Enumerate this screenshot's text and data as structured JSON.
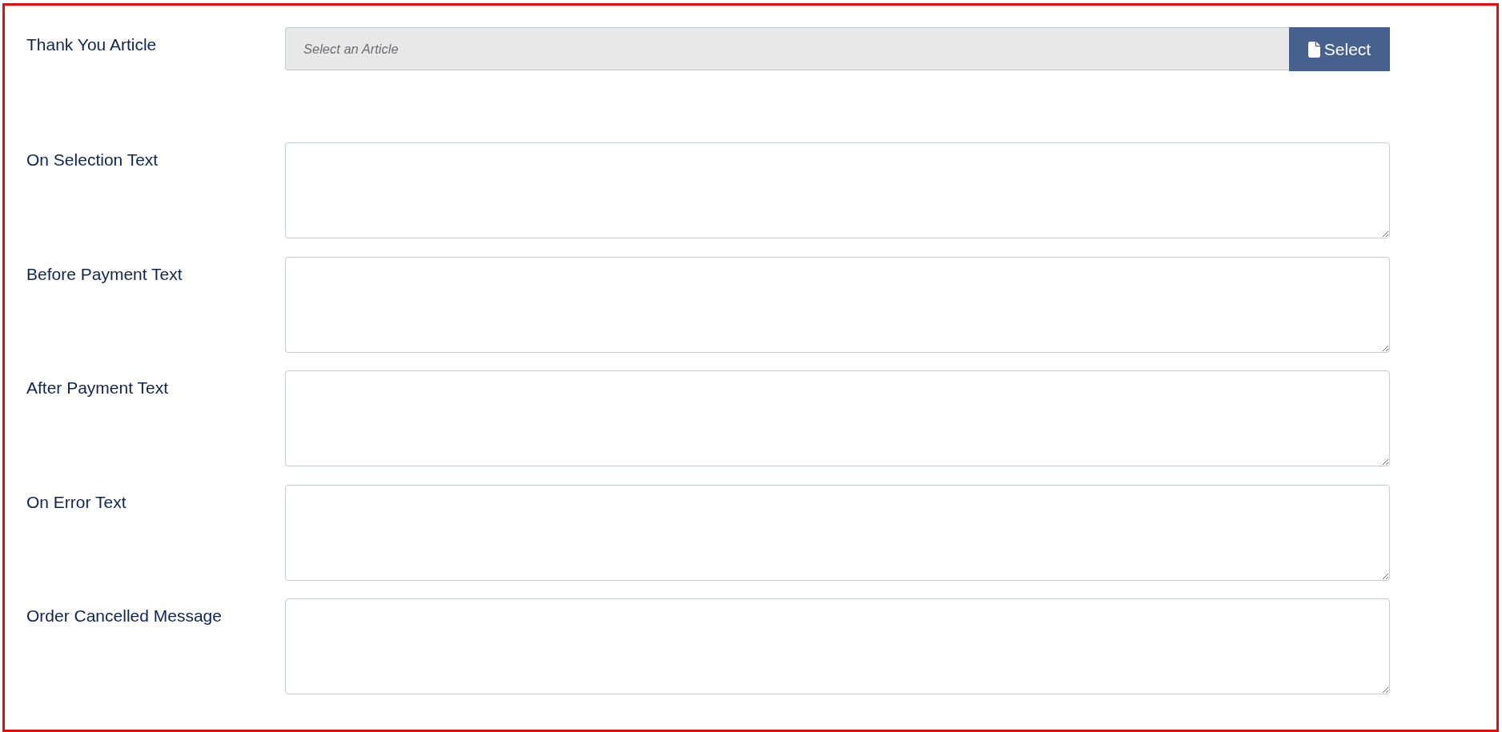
{
  "form": {
    "fields": [
      {
        "kind": "article_picker",
        "label": "Thank You Article",
        "placeholder": "Select an Article",
        "button": "Select"
      },
      {
        "kind": "textarea",
        "label": "On Selection Text"
      },
      {
        "kind": "textarea",
        "label": "Before Payment Text"
      },
      {
        "kind": "textarea",
        "label": "After Payment Text"
      },
      {
        "kind": "textarea",
        "label": "On Error Text"
      },
      {
        "kind": "textarea",
        "label": "Order Cancelled Message"
      }
    ]
  }
}
